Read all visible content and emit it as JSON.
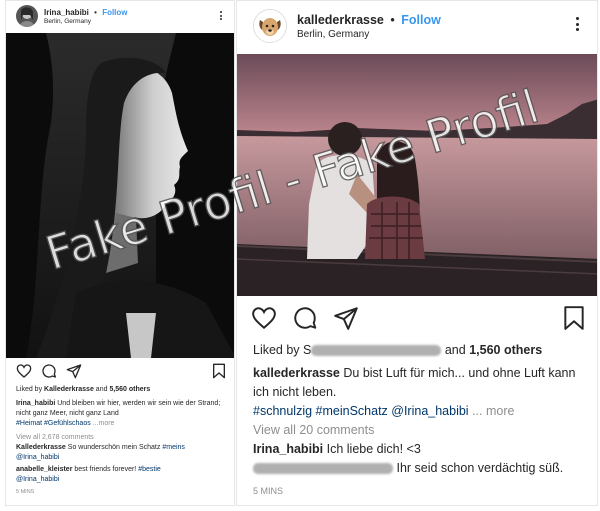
{
  "left_post": {
    "username": "Irina_habibi",
    "separator": "•",
    "follow_label": "Follow",
    "location": "Berlin, Germany",
    "likes": {
      "prefix": "Liked by ",
      "user": "Kallederkrasse",
      "middle": " and ",
      "count": "5,560 others"
    },
    "caption": {
      "user": "Irina_habibi",
      "text": " Und bleiben wir hier, werden wir sein wie der Strand; nicht ganz Meer, nicht ganz Land",
      "tags": "#Heimat #Gefühlschaos",
      "more": " ...more"
    },
    "view_comments": "View all 2,678 comments",
    "comments": [
      {
        "user": "Kallederkrasse",
        "text": " So wunderschön mein Schatz",
        "tag": "#meins",
        "mention": "@Irina_habibi"
      },
      {
        "user": "anabelle_kleister",
        "text": " best friends forever! ",
        "tag": "#bestie",
        "mention": "@Irina_habibi"
      }
    ],
    "time": "5 MINS"
  },
  "right_post": {
    "username": "kallederkrasse",
    "separator": "•",
    "follow_label": "Follow",
    "location": "Berlin, Germany",
    "likes": {
      "prefix": "Liked by S",
      "middle": " and ",
      "count": "1,560 others"
    },
    "caption": {
      "user": "kallederkrasse",
      "text": " Du bist Luft für mich... und ohne Luft kann ich nicht leben.",
      "tags": "#schnulzig #meinSchatz @Irina_habibi",
      "more": " ... more"
    },
    "view_comments": "View all 20 comments",
    "comments": [
      {
        "user": "Irina_habibi",
        "text": " Ich liebe dich! <3"
      },
      {
        "text": " Ihr seid schon verdächtig süß."
      }
    ],
    "time": "5 MINS"
  },
  "watermark": "Fake Profil - Fake Profil",
  "colors": {
    "follow": "#3897f0",
    "tag": "#00376b",
    "muted": "#8e8e8e",
    "text": "#262626"
  },
  "icons": [
    "heart-icon",
    "comment-icon",
    "share-icon",
    "bookmark-icon",
    "more-options-icon"
  ]
}
